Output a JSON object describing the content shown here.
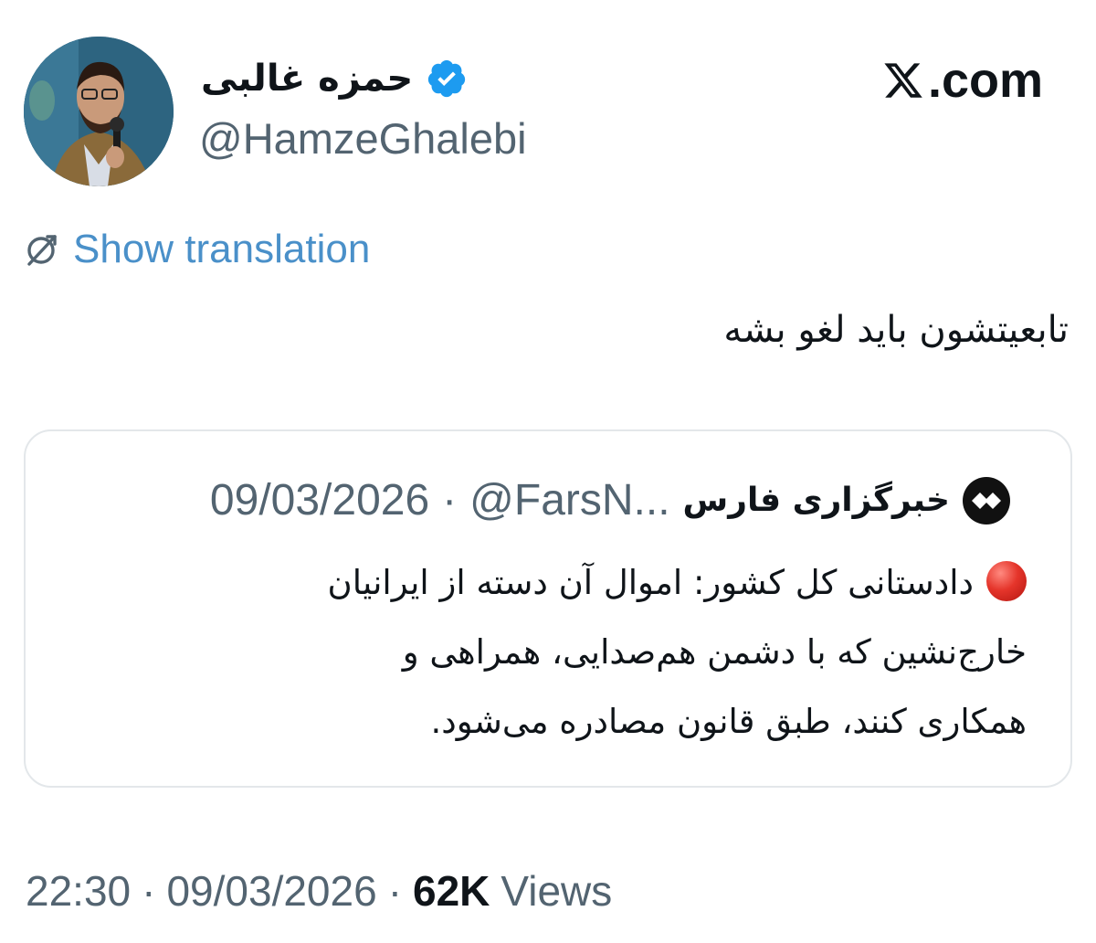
{
  "author": {
    "display_name": "حمزه غالبی",
    "handle": "@HamzeGhalebi",
    "verified": true,
    "avatar_icon": "profile-photo-icon"
  },
  "site": {
    "domain": ".com",
    "logo_icon": "x-logo-icon"
  },
  "translation": {
    "label": "Show translation",
    "icon": "translate-icon"
  },
  "tweet": {
    "text": "تابعیتشون باید لغو بشه"
  },
  "quoted_tweet": {
    "display_name": "خبرگزاری فارس",
    "handle": "@FarsN...",
    "separator": "·",
    "date": "09/03/2026",
    "lines": [
      "دادستانی کل کشور: اموال آن دسته از ایرانیان",
      "خارج‌نشین که با دشمن هم‌صدایی، همراهی و",
      "همکاری کنند، طبق قانون مصادره می‌شود."
    ],
    "lead_icon": "red-circle-icon"
  },
  "footer": {
    "time": "22:30",
    "separator": "·",
    "date": "09/03/2026",
    "views_count": "62K",
    "views_label": "Views"
  },
  "colors": {
    "link_blue": "#4a90c9",
    "verified_blue": "#1d9bf0",
    "muted_gray": "#536471",
    "text_black": "#0f1419",
    "border_gray": "#e3e7ea",
    "red_dot": "#e5352b"
  }
}
